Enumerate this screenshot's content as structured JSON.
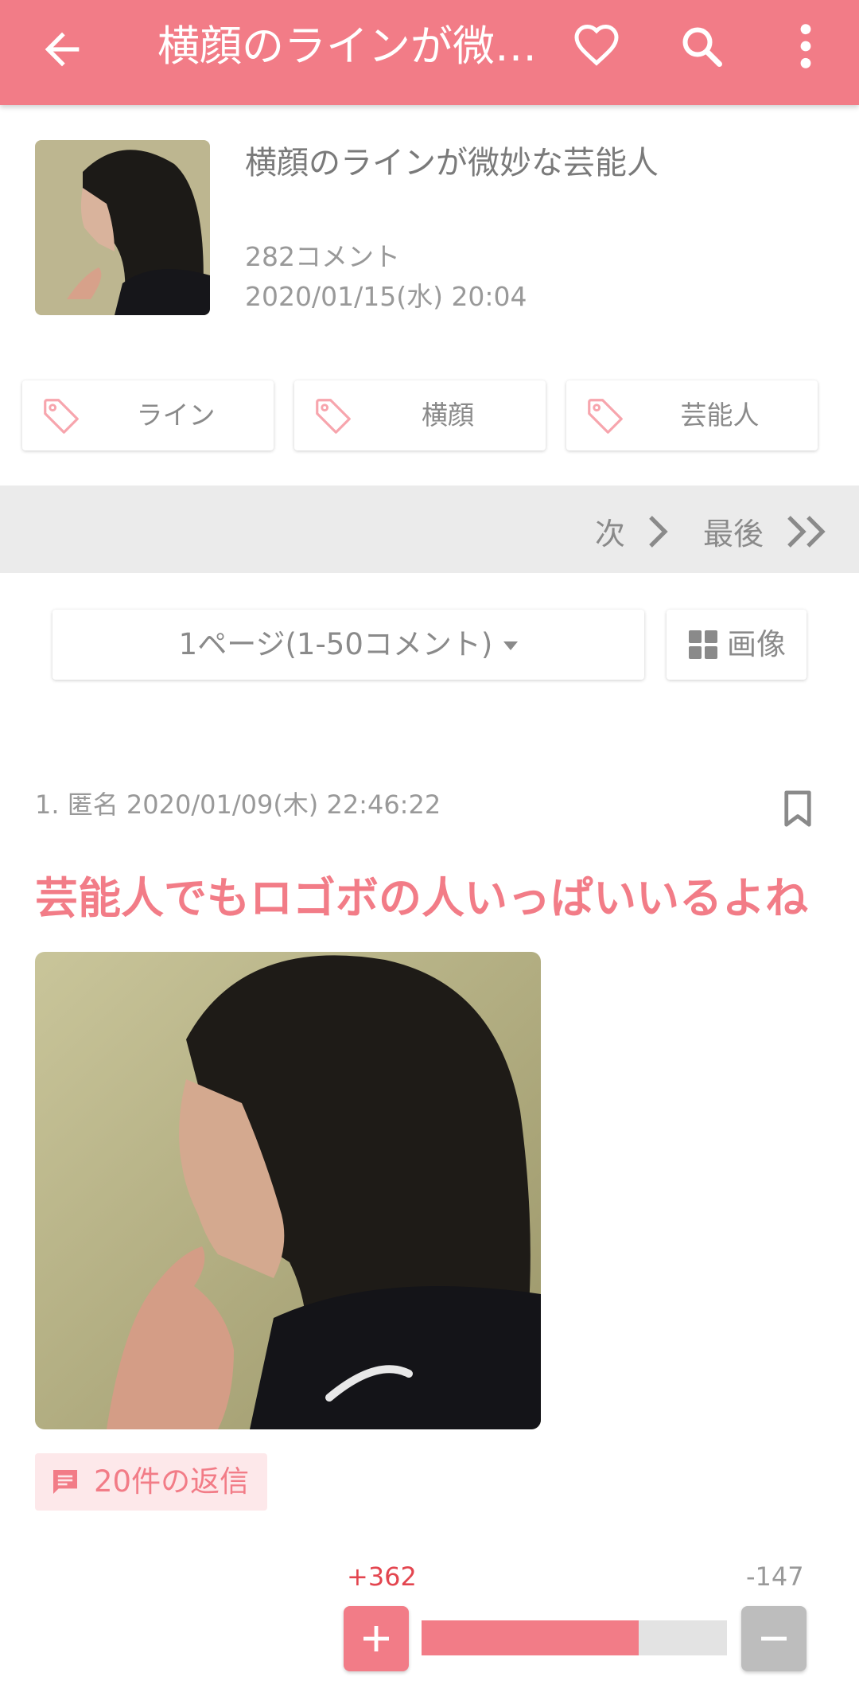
{
  "app_bar": {
    "title": "横顔のラインが微…",
    "icons": [
      "back-arrow-icon",
      "heart-icon",
      "search-icon",
      "more-vert-icon"
    ],
    "color": "#f27c87"
  },
  "topic": {
    "title": "横顔のラインが微妙な芸能人",
    "comment_count": "282コメント",
    "date": "2020/01/15(水) 20:04"
  },
  "tags": [
    {
      "label": "ライン"
    },
    {
      "label": "横顔"
    },
    {
      "label": "芸能人"
    }
  ],
  "pager": {
    "next_label": "次",
    "last_label": "最後"
  },
  "page_select": {
    "label": "1ページ(1-50コメント)"
  },
  "image_button": {
    "label": "画像"
  },
  "comment": {
    "meta": "1. 匿名 2020/01/09(木) 22:46:22",
    "text": "芸能人でもロゴボの人いっぱいいるよね",
    "reply_label": "20件の返信",
    "plus_count": "+362",
    "minus_count": "-147",
    "plus_ratio": 0.711
  },
  "colors": {
    "accent": "#f27c87",
    "plus_text": "#e3454f",
    "pager_bg": "#ebebeb",
    "minus_button": "#bdbdbd"
  }
}
